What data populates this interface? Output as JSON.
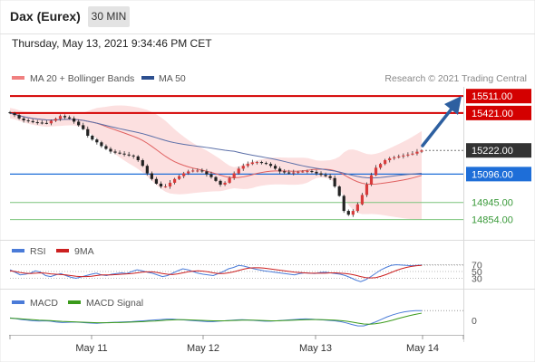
{
  "header": {
    "instrument": "Dax (Eurex)",
    "timeframe": "30 MIN"
  },
  "timestamp": "Thursday, May 13, 2021 9:34:46 PM CET",
  "copyright": "Research © 2021 Trading Central",
  "colors": {
    "resistance": "#d40000",
    "pivot": "#1e6ed8",
    "support": "#3a9a3a",
    "last": "#333333",
    "up_candle": "#d83a3a",
    "down_candle": "#222222",
    "bollinger": "#fbd6d6",
    "ma20": "#e06060",
    "ma50": "#5b6fa8",
    "rsi": "#4a7bd8",
    "rsi_ma": "#cc2020",
    "macd": "#4a7bd8",
    "macd_signal": "#3a9a1a",
    "arrow": "#2d5fa0"
  },
  "chart_data": [
    {
      "type": "candlestick",
      "legend": [
        {
          "name": "MA 20 + Bollinger Bands",
          "color": "#f08080"
        },
        {
          "name": "MA 50",
          "color": "#2d4f8f"
        }
      ],
      "x_labels": [
        "May 11",
        "May 12",
        "May 13",
        "May 14"
      ],
      "ylim": [
        14780,
        15560
      ],
      "levels": [
        {
          "value": 15511.0,
          "label": "15511.00",
          "kind": "resistance"
        },
        {
          "value": 15421.0,
          "label": "15421.00",
          "kind": "resistance"
        },
        {
          "value": 15222.0,
          "label": "15222.00",
          "kind": "last"
        },
        {
          "value": 15096.0,
          "label": "15096.00",
          "kind": "pivot"
        },
        {
          "value": 14945.0,
          "label": "14945.00",
          "kind": "support"
        },
        {
          "value": 14854.0,
          "label": "14854.00",
          "kind": "support"
        }
      ],
      "close": [
        15420,
        15410,
        15392,
        15382,
        15378,
        15372,
        15370,
        15368,
        15366,
        15380,
        15390,
        15405,
        15398,
        15392,
        15375,
        15356,
        15335,
        15300,
        15280,
        15265,
        15245,
        15230,
        15216,
        15210,
        15205,
        15200,
        15195,
        15190,
        15170,
        15140,
        15100,
        15070,
        15045,
        15030,
        15030,
        15050,
        15070,
        15085,
        15100,
        15110,
        15115,
        15115,
        15110,
        15095,
        15080,
        15060,
        15040,
        15050,
        15075,
        15100,
        15125,
        15140,
        15150,
        15158,
        15160,
        15155,
        15150,
        15140,
        15125,
        15110,
        15105,
        15100,
        15105,
        15108,
        15110,
        15112,
        15108,
        15100,
        15092,
        15085,
        15075,
        15030,
        14980,
        14900,
        14880,
        14900,
        14935,
        14985,
        15040,
        15090,
        15130,
        15150,
        15170,
        15180,
        15185,
        15190,
        15195,
        15200,
        15205,
        15215,
        15222
      ]
    },
    {
      "type": "line",
      "legend": [
        {
          "name": "RSI",
          "color": "#4a7bd8"
        },
        {
          "name": "9MA",
          "color": "#cc2020"
        }
      ],
      "ylim": [
        10,
        90
      ],
      "levels": [
        {
          "value": 70,
          "label": "70"
        },
        {
          "value": 50,
          "label": "50"
        },
        {
          "value": 30,
          "label": "30"
        }
      ],
      "series": [
        {
          "name": "RSI",
          "values": [
            55,
            48,
            40,
            42,
            45,
            52,
            48,
            38,
            35,
            40,
            44,
            38,
            33,
            30,
            34,
            38,
            42,
            45,
            40,
            38,
            42,
            44,
            46,
            44,
            50,
            55,
            52,
            48,
            45,
            40,
            35,
            38,
            45,
            52,
            58,
            55,
            50,
            45,
            42,
            40,
            38,
            44,
            50,
            58,
            62,
            68,
            66,
            62,
            58,
            55,
            52,
            50,
            48,
            46,
            44,
            42,
            40,
            44,
            46,
            45,
            44,
            47,
            48,
            46,
            44,
            42,
            38,
            32,
            25,
            20,
            26,
            35,
            45,
            55,
            62,
            68,
            70,
            69,
            68,
            67,
            68,
            69
          ]
        },
        {
          "name": "9MA",
          "values": [
            52,
            50,
            47,
            45,
            44,
            45,
            46,
            45,
            43,
            42,
            41,
            40,
            38,
            36,
            35,
            35,
            36,
            38,
            40,
            40,
            40,
            41,
            42,
            43,
            44,
            46,
            48,
            49,
            49,
            47,
            44,
            42,
            41,
            43,
            46,
            49,
            51,
            52,
            51,
            49,
            46,
            44,
            44,
            46,
            49,
            53,
            57,
            60,
            61,
            61,
            60,
            58,
            56,
            54,
            52,
            50,
            48,
            47,
            46,
            45,
            45,
            45,
            45,
            46,
            46,
            45,
            44,
            42,
            39,
            35,
            32,
            31,
            32,
            36,
            41,
            47,
            53,
            58,
            62,
            65,
            67,
            68
          ]
        }
      ]
    },
    {
      "type": "line",
      "legend": [
        {
          "name": "MACD",
          "color": "#4a7bd8"
        },
        {
          "name": "MACD Signal",
          "color": "#3a9a1a"
        }
      ],
      "ylim": [
        -60,
        60
      ],
      "levels": [
        {
          "value": 0,
          "label": "0"
        }
      ],
      "series": [
        {
          "name": "MACD",
          "values": [
            12,
            8,
            4,
            1,
            -2,
            -3,
            -2,
            -4,
            -8,
            -10,
            -9,
            -8,
            -9,
            -11,
            -13,
            -14,
            -12,
            -10,
            -9,
            -8,
            -7,
            -6,
            -4,
            -2,
            0,
            2,
            4,
            6,
            6,
            4,
            2,
            0,
            -2,
            -4,
            -6,
            -6,
            -4,
            -2,
            0,
            2,
            3,
            2,
            0,
            -2,
            -4,
            -4,
            -2,
            0,
            2,
            4,
            6,
            7,
            6,
            4,
            2,
            0,
            -2,
            -6,
            -12,
            -20,
            -26,
            -26,
            -18,
            -8,
            4,
            16,
            26,
            34,
            40,
            44,
            46,
            46
          ]
        },
        {
          "name": "MACD Signal",
          "values": [
            10,
            9,
            7,
            5,
            3,
            1,
            0,
            -1,
            -3,
            -5,
            -6,
            -7,
            -8,
            -9,
            -10,
            -11,
            -11,
            -11,
            -10,
            -10,
            -9,
            -8,
            -7,
            -6,
            -4,
            -3,
            -1,
            1,
            2,
            3,
            3,
            2,
            1,
            0,
            -1,
            -2,
            -2,
            -2,
            -1,
            0,
            1,
            1,
            1,
            0,
            -1,
            -2,
            -2,
            -1,
            0,
            1,
            2,
            3,
            4,
            4,
            3,
            2,
            1,
            -1,
            -4,
            -8,
            -13,
            -17,
            -18,
            -16,
            -12,
            -6,
            1,
            9,
            16,
            23,
            29,
            34
          ]
        }
      ]
    }
  ]
}
